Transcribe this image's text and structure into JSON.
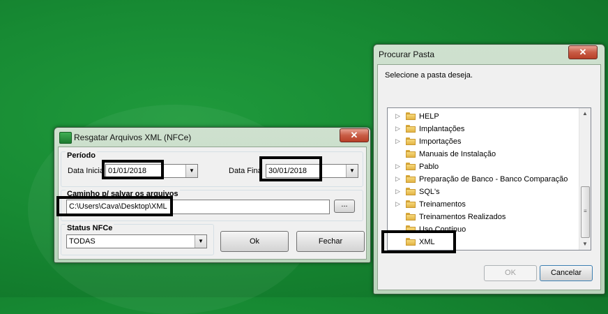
{
  "resgatar": {
    "title": "Resgatar Arquivos XML (NFCe)",
    "close_icon": "✕",
    "periodo": {
      "label": "Período",
      "data_inicial_label": "Data Inicia",
      "data_inicial_value": "01/01/2018",
      "data_final_label": "Data Fina",
      "data_final_value": "30/01/2018"
    },
    "caminho": {
      "label": "Caminho p/ salvar os arquivos",
      "value": "C:\\Users\\Cava\\Desktop\\XML",
      "browse_label": "..."
    },
    "status": {
      "label": "Status NFCe",
      "selected": "TODAS"
    },
    "ok_label": "Ok",
    "fechar_label": "Fechar"
  },
  "procurar": {
    "title": "Procurar Pasta",
    "close_icon": "✕",
    "instruction": "Selecione a pasta deseja.",
    "folders": [
      {
        "name": "HELP",
        "expandable": true
      },
      {
        "name": "Implantações",
        "expandable": true
      },
      {
        "name": "Importações",
        "expandable": true
      },
      {
        "name": "Manuais de Instalação",
        "expandable": false
      },
      {
        "name": "Pablo",
        "expandable": true
      },
      {
        "name": "Preparação de Banco - Banco Comparação",
        "expandable": true
      },
      {
        "name": "SQL's",
        "expandable": true
      },
      {
        "name": "Treinamentos",
        "expandable": true
      },
      {
        "name": "Treinamentos Realizados",
        "expandable": false
      },
      {
        "name": "Uso Contínuo",
        "expandable": false
      },
      {
        "name": "XML",
        "expandable": false
      }
    ],
    "ok_label": "OK",
    "cancelar_label": "Cancelar"
  },
  "colors": {
    "desktop_green": "#178a33",
    "highlight": "#000000",
    "close_red": "#c85c45"
  }
}
